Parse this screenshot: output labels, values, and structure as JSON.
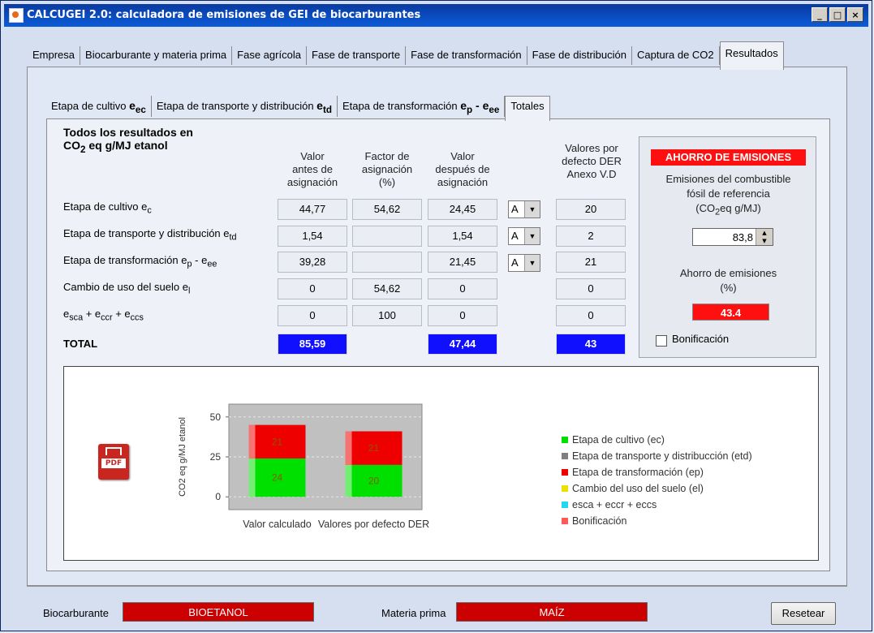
{
  "window": {
    "title": "CALCUGEI 2.0: calculadora de emisiones de GEI de biocarburantes"
  },
  "main_tabs": [
    "Empresa",
    "Biocarburante y materia prima",
    "Fase agrícola",
    "Fase de transporte",
    "Fase de transformación",
    "Fase de distribución",
    "Captura de CO2",
    "Resultados"
  ],
  "sub_tabs": {
    "t1": "Etapa de cultivo ",
    "t1_sub": "e",
    "t1_ss": "ec",
    "t2": "Etapa de transporte y distribución ",
    "t2_sub": "e",
    "t2_ss": "td",
    "t3": "Etapa de transformación ",
    "t3_a": "e",
    "t3_as": "p",
    "t3_sep": " - ",
    "t3_b": "e",
    "t3_bs": "ee",
    "t4": "Totales"
  },
  "heading": {
    "line1": "Todos los resultados en",
    "line2a": "CO",
    "line2s": "2",
    "line2b": " eq g/MJ etanol"
  },
  "columns": {
    "before": [
      "Valor",
      "antes de",
      "asignación"
    ],
    "factor": [
      "Factor de",
      "asignación",
      "(%)"
    ],
    "after": [
      "Valor",
      "después de",
      "asignación"
    ],
    "default": [
      "Valores por",
      "defecto DER",
      "Anexo V.D"
    ]
  },
  "rows": [
    {
      "label": "Etapa de cultivo e",
      "sub": "c",
      "before": "44,77",
      "factor": "54,62",
      "after": "24,45",
      "combo": "A",
      "default": "20"
    },
    {
      "label": "Etapa de transporte y distribución e",
      "sub": "td",
      "before": "1,54",
      "factor": "",
      "after": "1,54",
      "combo": "A",
      "default": "2"
    },
    {
      "label": "Etapa de transformación e",
      "sub": "p",
      "label2": " - e",
      "sub2": "ee",
      "before": "39,28",
      "factor": "",
      "after": "21,45",
      "combo": "A",
      "default": "21"
    },
    {
      "label": "Cambio de uso del suelo e",
      "sub": "l",
      "before": "0",
      "factor": "54,62",
      "after": "0",
      "combo": "",
      "default": "0"
    },
    {
      "label": "e",
      "sub": "sca",
      "label2": " + e",
      "sub2": "ccr",
      "label3": " + e",
      "sub3": "ccs",
      "before": "0",
      "factor": "100",
      "after": "0",
      "combo": "",
      "default": "0"
    }
  ],
  "total": {
    "label": "TOTAL",
    "before": "85,59",
    "after": "47,44",
    "default": "43"
  },
  "savings": {
    "title": "AHORRO DE EMISIONES",
    "ref_l1": "Emisiones del combustible",
    "ref_l2": "fósil de referencia",
    "ref_l3a": "(CO",
    "ref_l3s": "2",
    "ref_l3b": "eq g/MJ)",
    "ref_value": "83,8",
    "pct_l1": "Ahorro de emisiones",
    "pct_l2": "(%)",
    "pct_value": "43.4",
    "bonus": "Bonificación"
  },
  "pdf_label": "PDF",
  "chart_data": {
    "type": "bar",
    "stacked": true,
    "ylabel": "CO2 eq g/MJ etanol",
    "yticks": [
      0,
      25,
      50
    ],
    "ylim": [
      -8,
      58
    ],
    "categories": [
      "Valor calculado",
      "Valores por defecto DER"
    ],
    "series": [
      {
        "name": "Etapa de cultivo (ec)",
        "color": "#00e000",
        "values": [
          24,
          20
        ],
        "labels": [
          "24",
          "20"
        ]
      },
      {
        "name": "Etapa de transporte y distribucción (etd)",
        "color": "#808080",
        "values": [
          0,
          0
        ],
        "labels": [
          "",
          ""
        ]
      },
      {
        "name": "Etapa de transformación (ep)",
        "color": "#ee0000",
        "values": [
          21,
          21
        ],
        "labels": [
          "21",
          "21"
        ]
      },
      {
        "name": "Cambio del uso del suelo (el)",
        "color": "#f0e000",
        "values": [
          0,
          0
        ],
        "labels": [
          "",
          ""
        ]
      },
      {
        "name": "esca + eccr + eccs",
        "color": "#20d8f0",
        "values": [
          0,
          0
        ],
        "labels": [
          "",
          ""
        ]
      },
      {
        "name": "Bonificación",
        "color": "#ff5a5a",
        "values": [
          0,
          0
        ],
        "labels": [
          "",
          ""
        ]
      }
    ],
    "plot_bg": "#c0c0c0",
    "grid": true
  },
  "bottom": {
    "bio_label": "Biocarburante",
    "bio_value": "BIOETANOL",
    "mp_label": "Materia prima",
    "mp_value": "MAÍZ",
    "reset": "Resetear"
  }
}
